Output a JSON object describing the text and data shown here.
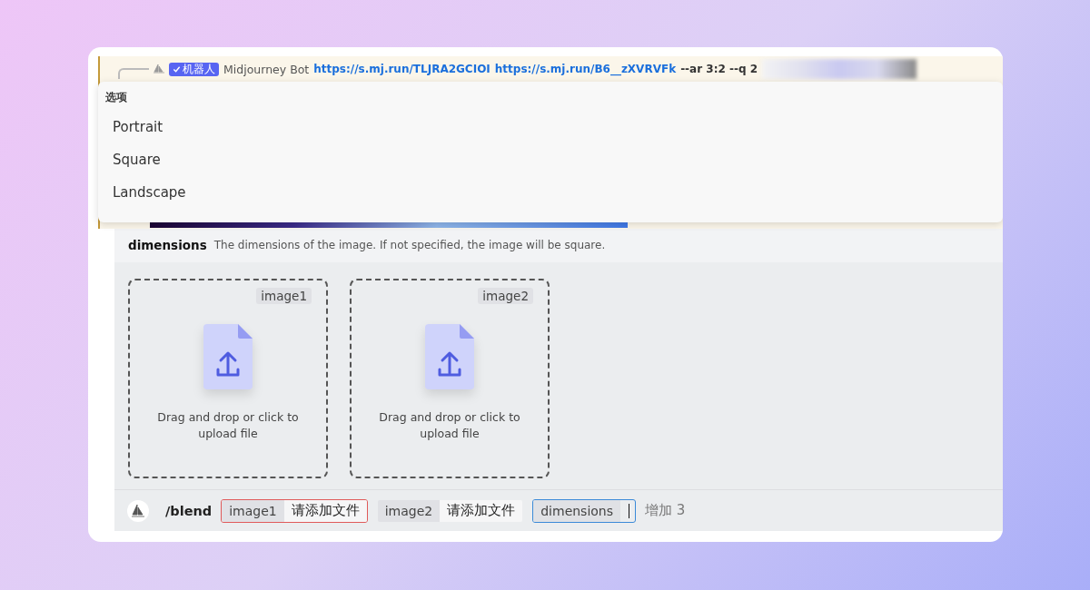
{
  "reply_preview": {
    "badge": "机器人",
    "author": "Midjourney Bot",
    "links": [
      "https://s.mj.run/TLJRA2GCIOI",
      "https://s.mj.run/B6__zXVRVFk"
    ],
    "params": "--ar 3:2 --q 2"
  },
  "options_menu": {
    "title": "选项",
    "items": [
      {
        "label": "Portrait"
      },
      {
        "label": "Square"
      },
      {
        "label": "Landscape"
      }
    ]
  },
  "option_hint": {
    "name": "dimensions",
    "description": "The dimensions of the image. If not specified, the image will be square."
  },
  "uploads": [
    {
      "tag": "image1",
      "text": "Drag and drop or click to upload file"
    },
    {
      "tag": "image2",
      "text": "Drag and drop or click to upload file"
    }
  ],
  "command": {
    "name": "/blend",
    "chips": [
      {
        "option": "image1",
        "value": "请添加文件",
        "error": true,
        "focused": false
      },
      {
        "option": "image2",
        "value": "请添加文件",
        "error": false,
        "focused": false
      },
      {
        "option": "dimensions",
        "error": false,
        "focused": true
      }
    ],
    "more": "增加 3"
  }
}
